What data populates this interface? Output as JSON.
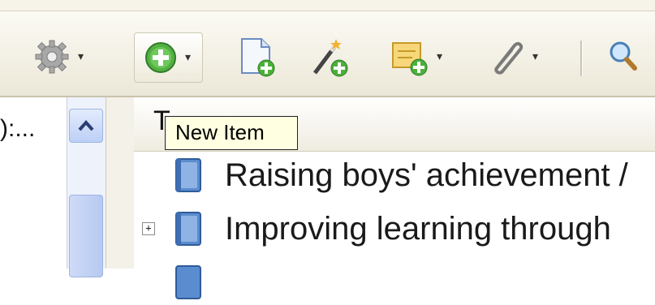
{
  "toolbar": {
    "buttons": [
      {
        "icon": "gear-icon",
        "has_dropdown": true
      },
      {
        "icon": "new-item-icon",
        "has_dropdown": true
      },
      {
        "icon": "new-note-icon",
        "has_dropdown": false
      },
      {
        "icon": "magic-wand-add-icon",
        "has_dropdown": false
      },
      {
        "icon": "add-attachment-icon",
        "has_dropdown": true
      },
      {
        "icon": "paperclip-icon",
        "has_dropdown": true
      },
      {
        "icon": "search-icon",
        "has_dropdown": false
      }
    ],
    "caret": "▾"
  },
  "tooltip": {
    "text": "New Item"
  },
  "left_pane": {
    "truncated_text": "):..."
  },
  "column_header": {
    "partial_label": "T"
  },
  "items": [
    {
      "title": "Raising boys' achievement /",
      "expandable": false
    },
    {
      "title": "Improving learning through",
      "expandable": true,
      "expander": "+"
    }
  ],
  "colors": {
    "toolbar_bg": "#ece8d8",
    "tooltip_bg": "#ffffe1",
    "book_icon": "#5b8ccf",
    "add_green": "#4caf3a",
    "scroll_blue": "#bccff6"
  }
}
